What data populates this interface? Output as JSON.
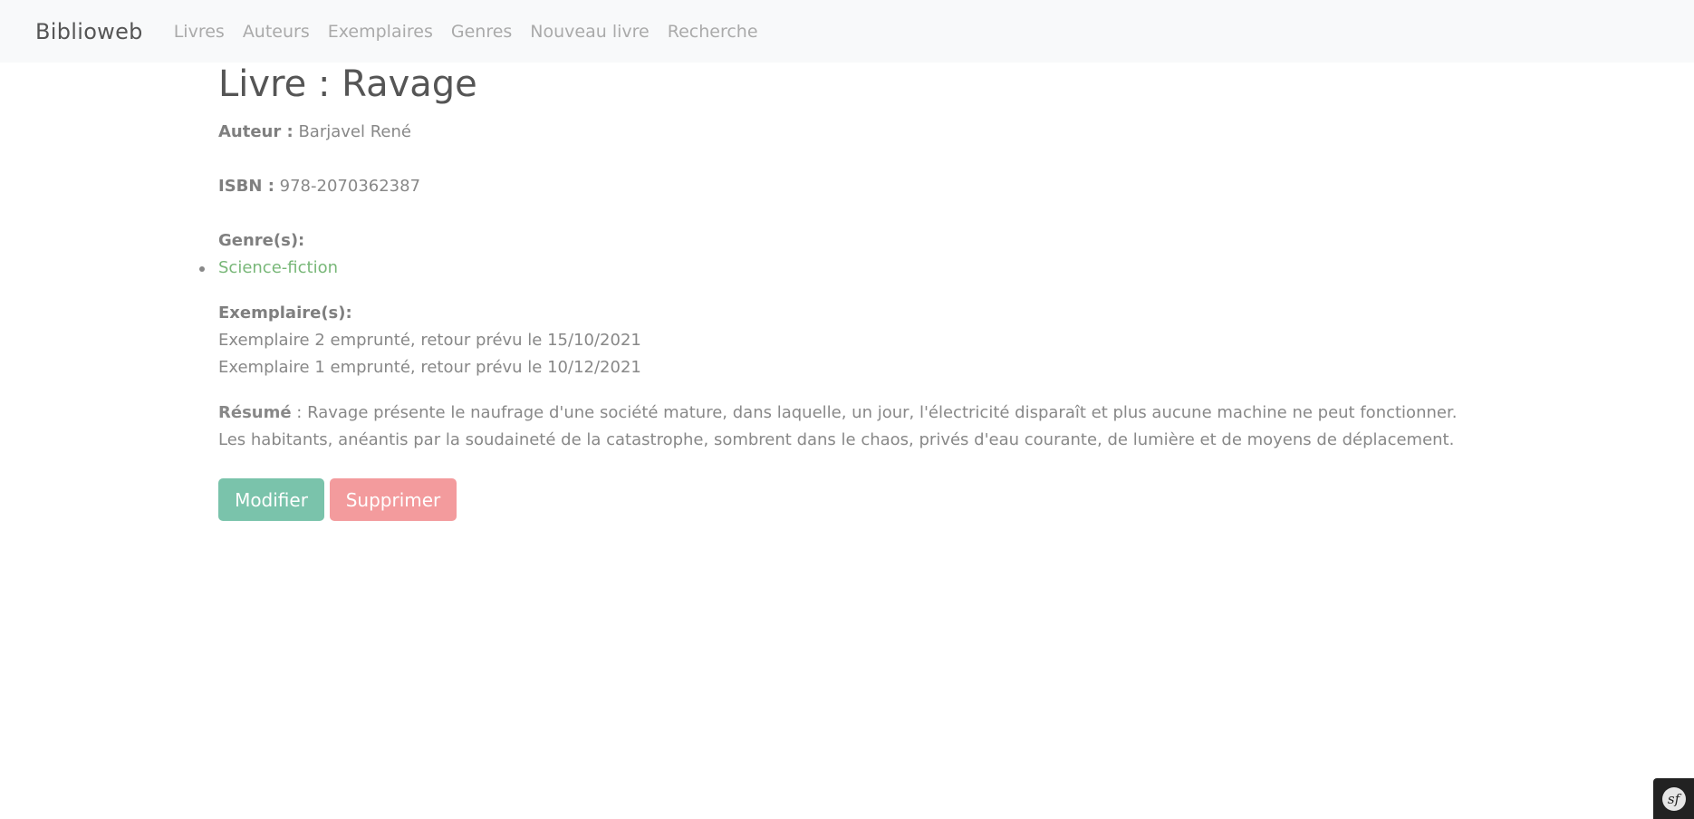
{
  "navbar": {
    "brand": "Biblioweb",
    "links": [
      "Livres",
      "Auteurs",
      "Exemplaires",
      "Genres",
      "Nouveau livre",
      "Recherche"
    ]
  },
  "book": {
    "title": "Livre : Ravage",
    "author_label": "Auteur :",
    "author": "Barjavel René",
    "isbn_label": "ISBN :",
    "isbn": "978-2070362387",
    "genres_label": "Genre(s):",
    "genres": [
      "Science-fiction"
    ],
    "copies_label": "Exemplaire(s):",
    "copies": [
      "Exemplaire 2 emprunté, retour prévu le 15/10/2021",
      "Exemplaire 1 emprunté, retour prévu le 10/12/2021"
    ],
    "summary_label": "Résumé",
    "summary": ": Ravage présente le naufrage d'une société mature, dans laquelle, un jour, l'électricité disparaît et plus aucune machine ne peut fonctionner. Les habitants, anéantis par la soudaineté de la catastrophe, sombrent dans le chaos, privés d'eau courante, de lumière et de moyens de déplacement."
  },
  "actions": {
    "edit_label": "Modifier",
    "delete_label": "Supprimer"
  },
  "toolbar": {
    "icon": "symfony-logo-icon",
    "glyph": "sf"
  }
}
